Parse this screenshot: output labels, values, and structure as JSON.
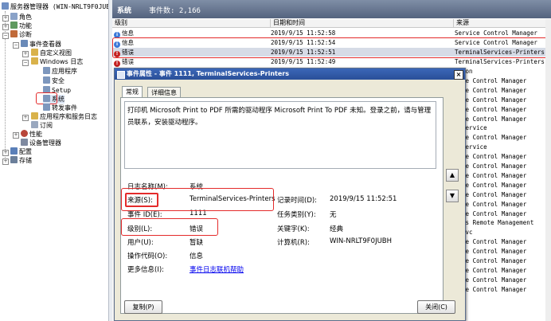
{
  "tree": {
    "root": "服务器管理器 (WIN-NRLT9F0JUB",
    "items": [
      {
        "label": "角色"
      },
      {
        "label": "功能"
      },
      {
        "label": "诊断"
      },
      {
        "label": "事件查看器"
      },
      {
        "label": "自定义视图"
      },
      {
        "label": "Windows 日志"
      },
      {
        "label": "应用程序"
      },
      {
        "label": "安全"
      },
      {
        "label": "Setup"
      },
      {
        "label": "系统"
      },
      {
        "label": "转发事件"
      },
      {
        "label": "应用程序和服务日志"
      },
      {
        "label": "订阅"
      },
      {
        "label": "性能"
      },
      {
        "label": "设备管理器"
      },
      {
        "label": "配置"
      },
      {
        "label": "存储"
      }
    ]
  },
  "header": {
    "title": "系统",
    "count_label": "事件数: 2,166"
  },
  "columns": [
    "级别",
    "日期和时间",
    "来源"
  ],
  "events": [
    {
      "level": "信息",
      "kind": "info",
      "time": "2019/9/15 11:52:58",
      "source": "Service Control Manager"
    },
    {
      "level": "信息",
      "kind": "info",
      "time": "2019/9/15 11:52:54",
      "source": "Service Control Manager"
    },
    {
      "level": "错误",
      "kind": "error",
      "time": "2019/9/15 11:52:51",
      "source": "TerminalServices-Printers"
    },
    {
      "level": "错误",
      "kind": "error",
      "time": "2019/9/15 11:52:49",
      "source": "TerminalServices-Printers"
    }
  ],
  "sources_more": [
    "logon",
    "vice Control Manager",
    "vice Control Manager",
    "vice Control Manager",
    "vice Control Manager",
    "vice Control Manager",
    "e-Service",
    "vice Control Manager",
    "e-Service",
    "vice Control Manager",
    "vice Control Manager",
    "vice Control Manager",
    "vice Control Manager",
    "vice Control Manager",
    "vice Control Manager",
    "vice Control Manager",
    "dows Remote Management",
    "lpsvc",
    "vice Control Manager",
    "vice Control Manager",
    "vice Control Manager",
    "vice Control Manager",
    "vice Control Manager",
    "vice Control Manager"
  ],
  "dialog": {
    "title": "事件属性 - 事件 1111, TerminalServices-Printers",
    "close": "×",
    "tabs": [
      "常规",
      "详细信息"
    ],
    "description": "打印机 Microsoft Print to PDF 所需的驱动程序 Microsoft Print To PDF 未知。登录之前，请与管理员联系，安装驱动程序。",
    "props": {
      "log_name_label": "日志名称(M):",
      "log_name": "系统",
      "source_label": "来源(S):",
      "source": "TerminalServices-Printers",
      "logged_label": "记录时间(D):",
      "logged": "2019/9/15 11:52:51",
      "event_id_label": "事件 ID(E):",
      "event_id": "1111",
      "task_label": "任务类别(Y):",
      "task": "无",
      "level_label": "级别(L):",
      "level": "错误",
      "keywords_label": "关键字(K):",
      "keywords": "经典",
      "user_label": "用户(U):",
      "user": "暂缺",
      "computer_label": "计算机(R):",
      "computer": "WIN-NRLT9F0JUBH",
      "opcode_label": "操作代码(O):",
      "opcode": "信息",
      "more_label": "更多信息(I):",
      "more_link": "事件日志联机帮助"
    },
    "copy_button": "复制(P)",
    "close_button": "关闭(C)"
  },
  "colors": {
    "titlebar": "#54637e",
    "dialog_title": "#2a4f98",
    "highlight": "#e42b2b",
    "link": "#0000ee"
  }
}
